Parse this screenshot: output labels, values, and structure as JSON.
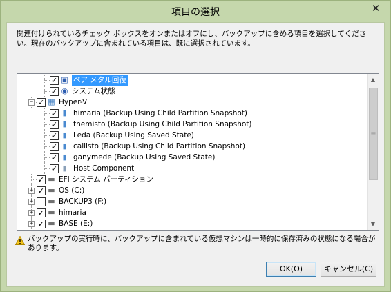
{
  "window": {
    "title": "項目の選択",
    "close_label": "✕"
  },
  "description": "関連付けられているチェック ボックスをオンまたはオフにし、バックアップに含める項目を選択してください。現在のバックアップに含まれている項目は、既に選択されています。",
  "tree": {
    "items": [
      {
        "label": "ベア メタル回復",
        "checked": true,
        "selected": true,
        "icon": "bare-metal-recovery-icon"
      },
      {
        "label": "システム状態",
        "checked": true,
        "icon": "system-state-icon"
      },
      {
        "label": "Hyper-V",
        "checked": true,
        "expanded": true,
        "icon": "hyper-v-icon"
      },
      {
        "label": "himaria (Backup Using Child Partition Snapshot)",
        "checked": true,
        "icon": "vm-icon"
      },
      {
        "label": "themisto (Backup Using Child Partition Snapshot)",
        "checked": true,
        "icon": "vm-icon"
      },
      {
        "label": "Leda (Backup Using Saved State)",
        "checked": true,
        "icon": "vm-icon"
      },
      {
        "label": "callisto (Backup Using Child Partition Snapshot)",
        "checked": true,
        "icon": "vm-icon"
      },
      {
        "label": "ganymede (Backup Using Saved State)",
        "checked": true,
        "icon": "vm-icon"
      },
      {
        "label": "Host Component",
        "checked": true,
        "icon": "host-component-icon"
      },
      {
        "label": "EFI システム パーティション",
        "checked": true,
        "icon": "drive-icon"
      },
      {
        "label": "OS (C:)",
        "checked": true,
        "expanded": false,
        "icon": "drive-icon"
      },
      {
        "label": "BACKUP3 (F:)",
        "checked": false,
        "expanded": false,
        "icon": "drive-icon"
      },
      {
        "label": "himaria",
        "checked": true,
        "expanded": false,
        "icon": "drive-icon"
      },
      {
        "label": "BASE (E:)",
        "checked": true,
        "expanded": false,
        "icon": "drive-icon"
      }
    ]
  },
  "warning": "バックアップの実行時に、バックアップに含まれている仮想マシンは一時的に保存済みの状態になる場合があります。",
  "buttons": {
    "ok": "OK(O)",
    "cancel": "キャンセル(C)"
  },
  "colors": {
    "frame": "#c5d7ac",
    "selection": "#3399ff"
  }
}
